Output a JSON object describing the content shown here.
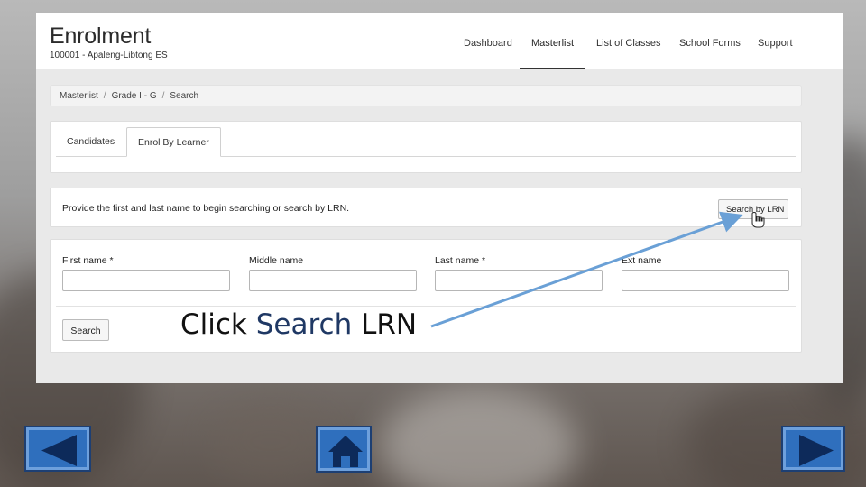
{
  "app": {
    "title": "Enrolment",
    "school": "100001 - Apaleng-Libtong ES"
  },
  "nav": {
    "items": [
      {
        "label": "Dashboard"
      },
      {
        "label": "Masterlist"
      },
      {
        "label": "List of Classes"
      },
      {
        "label": "School Forms"
      },
      {
        "label": "Support"
      }
    ],
    "active": "Masterlist"
  },
  "breadcrumb": [
    "Masterlist",
    "Grade I - G",
    "Search"
  ],
  "tabs": {
    "items": [
      {
        "label": "Candidates"
      },
      {
        "label": "Enrol By Learner"
      }
    ],
    "active": "Enrol By Learner"
  },
  "info": {
    "text": "Provide the first and last name to begin searching or search by LRN.",
    "button_label": "Search by LRN"
  },
  "form": {
    "fields": [
      {
        "label": "First name *",
        "value": ""
      },
      {
        "label": "Middle name",
        "value": ""
      },
      {
        "label": "Last name *",
        "value": ""
      },
      {
        "label": "Ext name",
        "value": ""
      }
    ],
    "search_label": "Search"
  },
  "callout": {
    "prefix": "Click ",
    "highlight": "Search",
    "suffix": " LRN"
  },
  "slide_nav": {
    "back_icon": "triangle-left-icon",
    "home_icon": "home-icon",
    "next_icon": "triangle-right-icon"
  },
  "colors": {
    "nav_button_fill": "#2f6fbd",
    "arrow": "#6aa0d6",
    "callout_highlight": "#1f3864"
  }
}
